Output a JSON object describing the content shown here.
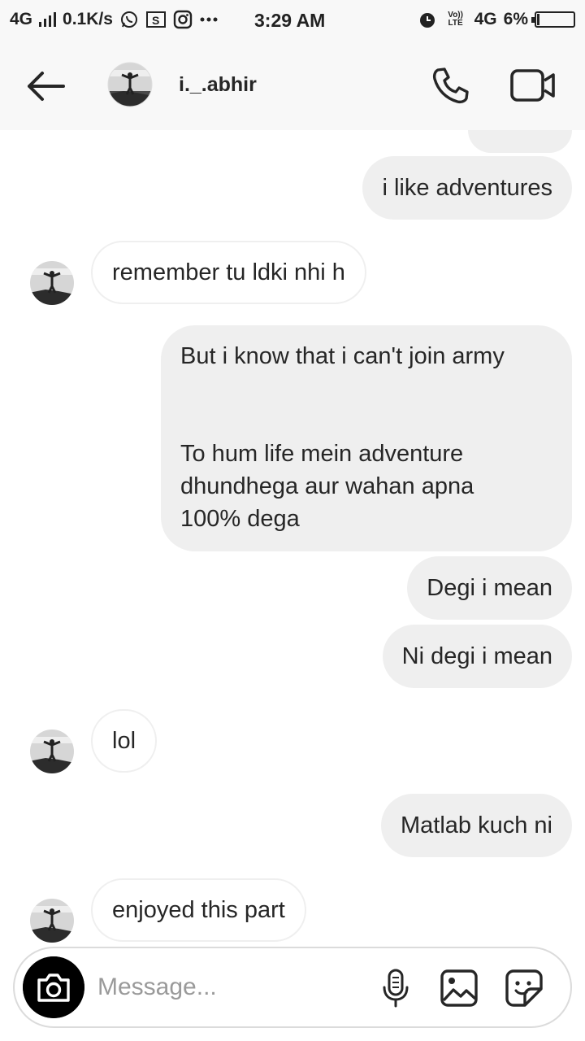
{
  "status_bar": {
    "network": "4G",
    "speed": "0.1K/s",
    "time": "3:29 AM",
    "volte": "Vo)) LTE",
    "network_right": "4G",
    "battery": "6%",
    "battery_level": 0.06
  },
  "header": {
    "username": "i._.abhir"
  },
  "messages": [
    {
      "side": "out",
      "text": "i like adventures"
    },
    {
      "side": "in",
      "text": "remember tu ldki nhi h"
    },
    {
      "side": "out",
      "lines": [
        "But i know that i can't join army",
        "",
        "",
        "To hum life mein adventure",
        "dhundhega aur wahan apna",
        "100% dega"
      ]
    },
    {
      "side": "out",
      "text": "Degi i mean"
    },
    {
      "side": "out",
      "text": "Ni degi i mean"
    },
    {
      "side": "in",
      "text": "lol"
    },
    {
      "side": "out",
      "text": "Matlab kuch ni"
    },
    {
      "side": "in",
      "text": "enjoyed this part"
    }
  ],
  "composer": {
    "placeholder": "Message..."
  },
  "icons": {
    "back": "arrow-left-icon",
    "call": "phone-icon",
    "video": "video-camera-icon",
    "camera": "camera-icon",
    "mic": "microphone-icon",
    "gallery": "image-icon",
    "sticker": "sticker-icon"
  }
}
